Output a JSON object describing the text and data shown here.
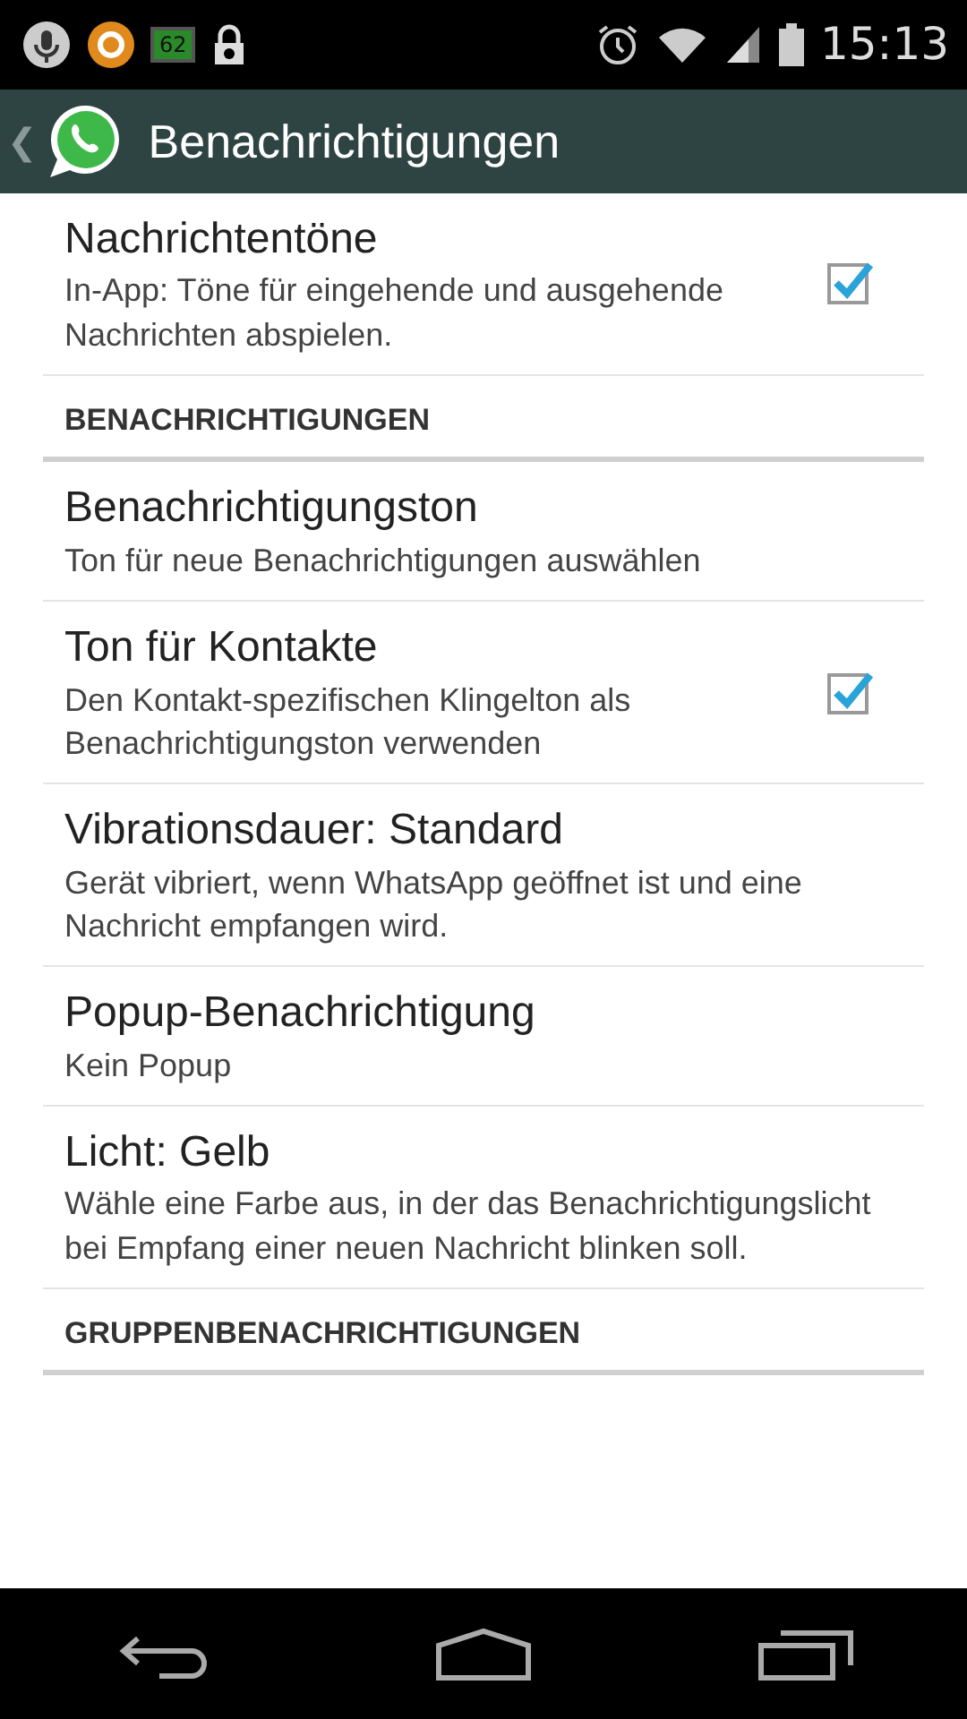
{
  "status_bar": {
    "battery_level_label": "62",
    "time": "15:13"
  },
  "action_bar": {
    "back": "❮",
    "title": "Benachrichtigungen"
  },
  "settings": [
    {
      "kind": "checkbox",
      "title": "Nachrichtentöne",
      "summary": "In-App: Töne für eingehende und ausgehende Nachrichten abspielen.",
      "checked": true
    },
    {
      "kind": "header",
      "title": "BENACHRICHTIGUNGEN"
    },
    {
      "kind": "plain",
      "title": "Benachrichtigungston",
      "summary": "Ton für neue Benachrichtigungen auswählen"
    },
    {
      "kind": "checkbox",
      "title": "Ton für Kontakte",
      "summary": "Den Kontakt-spezifischen Klingelton als Benachrichtigungston verwenden",
      "checked": true
    },
    {
      "kind": "plain",
      "title": "Vibrationsdauer: Standard",
      "summary": "Gerät vibriert, wenn WhatsApp geöffnet ist und eine Nachricht empfangen wird."
    },
    {
      "kind": "plain",
      "title": "Popup-Benachrichtigung",
      "summary": "Kein Popup"
    },
    {
      "kind": "plain",
      "title": "Licht: Gelb",
      "summary": "Wähle eine Farbe aus, in der das Benachrichtigungslicht bei Empfang einer neuen Nachricht blinken soll."
    },
    {
      "kind": "header",
      "title": "GRUPPENBENACHRICHTIGUNGEN"
    }
  ]
}
